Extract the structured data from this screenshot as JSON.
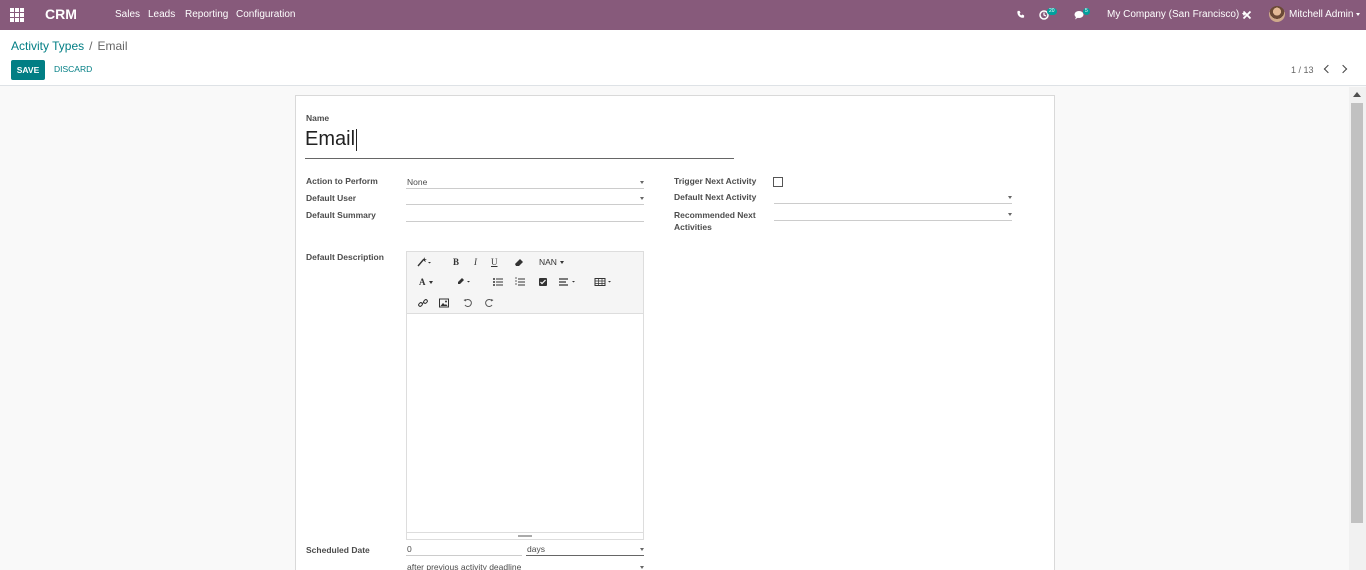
{
  "navbar": {
    "brand": "CRM",
    "menu": [
      "Sales",
      "Leads",
      "Reporting",
      "Configuration"
    ],
    "activity_count": "20",
    "message_count": "5",
    "company": "My Company (San Francisco)",
    "user": "Mitchell Admin",
    "color": "#875a7b"
  },
  "breadcrumb": {
    "parent": "Activity Types",
    "separator": "/",
    "current": "Email"
  },
  "actions": {
    "save": "SAVE",
    "discard": "DISCARD"
  },
  "pager": {
    "value": "1 / 13"
  },
  "form": {
    "name_label": "Name",
    "name_value": "Email",
    "action_label": "Action to Perform",
    "action_value": "None",
    "default_user_label": "Default User",
    "default_user_value": "",
    "default_summary_label": "Default Summary",
    "default_summary_value": "",
    "trigger_next_label": "Trigger Next Activity",
    "trigger_next_checked": false,
    "default_next_label": "Default Next Activity",
    "default_next_value": "",
    "recommended_label_1": "Recommended Next",
    "recommended_label_2": "Activities",
    "recommended_value": "",
    "description_label": "Default Description",
    "scheduled_label": "Scheduled Date",
    "scheduled_value": "0",
    "scheduled_unit": "days",
    "scheduled_from": "after previous activity deadline"
  },
  "editor": {
    "font_size": "NAN"
  },
  "colors": {
    "accent": "#017e84",
    "navbar": "#875a7b"
  }
}
